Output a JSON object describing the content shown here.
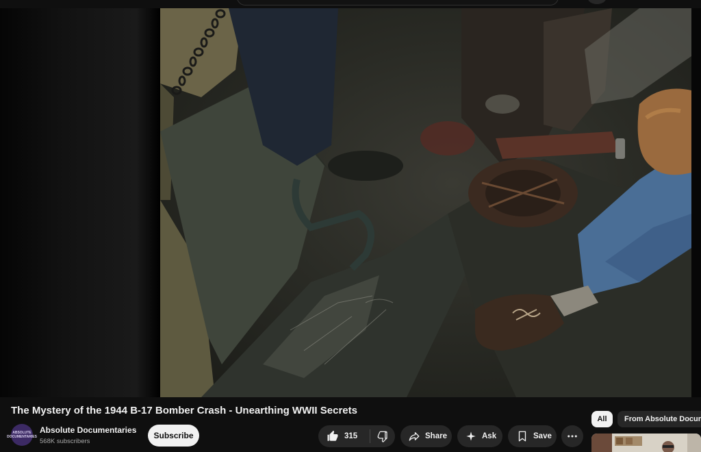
{
  "video": {
    "title": "The Mystery of the 1944 B-17 Bomber Crash - Unearthing WWII Secrets"
  },
  "channel": {
    "name": "Absolute Documentaries",
    "subscribers": "568K subscribers",
    "avatar_text": "ABSOLUTE DOCUMENTARIES"
  },
  "actions": {
    "subscribe": "Subscribe",
    "like_count": "315",
    "share": "Share",
    "ask": "Ask",
    "save": "Save"
  },
  "sidebar": {
    "chips": [
      {
        "label": "All",
        "selected": true
      },
      {
        "label": "From Absolute Documentaries",
        "selected": false
      }
    ]
  },
  "icons": [
    "thumbs-up-icon",
    "thumbs-down-icon",
    "share-arrow-icon",
    "sparkle-icon",
    "bookmark-icon",
    "more-horizontal-icon"
  ]
}
